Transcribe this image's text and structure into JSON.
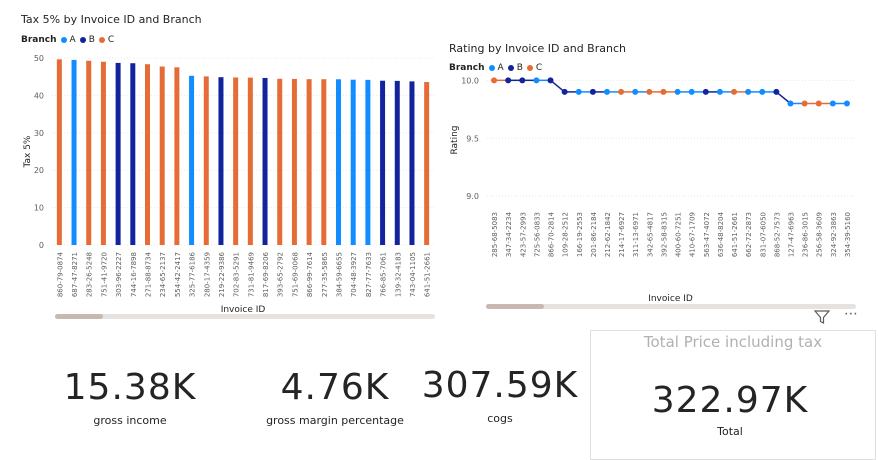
{
  "colors": {
    "A": "#118DFF",
    "B": "#12239E",
    "C": "#E66C37",
    "axis": "#605e5c",
    "grid": "#e8e8e8"
  },
  "left_chart": {
    "title": "Tax 5% by Invoice ID and Branch",
    "legend_title": "Branch",
    "legend": [
      "A",
      "B",
      "C"
    ],
    "xlabel": "Invoice ID",
    "ylabel": "Tax 5%"
  },
  "right_chart": {
    "title": "Rating by Invoice ID and Branch",
    "legend_title": "Branch",
    "legend": [
      "A",
      "B",
      "C"
    ],
    "xlabel": "Invoice ID",
    "ylabel": "Rating"
  },
  "kpis": {
    "gross_income": {
      "value": "15.38K",
      "label": "gross income"
    },
    "gross_margin": {
      "value": "4.76K",
      "label": "gross margin percentage"
    },
    "cogs": {
      "value": "307.59K",
      "label": "cogs"
    }
  },
  "total_card": {
    "title": "Total Price including tax",
    "value": "322.97K",
    "label": "Total"
  },
  "icons": [
    "filter-icon",
    "more-options-icon"
  ],
  "chart_data": [
    {
      "type": "bar",
      "title": "Tax 5% by Invoice ID and Branch",
      "xlabel": "Invoice ID",
      "ylabel": "Tax 5%",
      "ylim": [
        0,
        50
      ],
      "yticks": [
        0,
        10,
        20,
        30,
        40,
        50
      ],
      "grid": true,
      "legend_placement": "top-left",
      "categories": [
        "860-79-0874",
        "687-47-8271",
        "283-26-5248",
        "751-41-9720",
        "303-96-2227",
        "744-16-7898",
        "271-88-8734",
        "234-65-2137",
        "554-42-2417",
        "325-77-6186",
        "280-17-4359",
        "219-22-9386",
        "702-83-5291",
        "731-81-9469",
        "817-69-8206",
        "393-65-2792",
        "751-69-0068",
        "866-99-7614",
        "277-35-5865",
        "384-59-6655",
        "704-48-3927",
        "827-77-7633",
        "766-85-7061",
        "139-32-4183",
        "743-04-1105",
        "641-51-2661"
      ],
      "branches": [
        "C",
        "A",
        "C",
        "C",
        "B",
        "B",
        "C",
        "C",
        "C",
        "A",
        "C",
        "B",
        "C",
        "C",
        "B",
        "C",
        "C",
        "C",
        "C",
        "A",
        "A",
        "A",
        "B",
        "B",
        "B",
        "C"
      ],
      "values": [
        49.65,
        49.49,
        49.26,
        49.0,
        48.69,
        48.6,
        48.34,
        47.72,
        47.51,
        45.25,
        45.09,
        44.87,
        44.8,
        44.75,
        44.66,
        44.44,
        44.4,
        44.34,
        44.33,
        44.31,
        44.2,
        44.15,
        43.93,
        43.88,
        43.75,
        43.57
      ]
    },
    {
      "type": "line",
      "title": "Rating by Invoice ID and Branch",
      "xlabel": "Invoice ID",
      "ylabel": "Rating",
      "ylim": [
        8.95,
        10.02
      ],
      "yticks": [
        9.0,
        9.5,
        10.0
      ],
      "grid": true,
      "legend_placement": "top-left",
      "categories": [
        "285-68-5083",
        "347-34-2234",
        "423-57-2993",
        "725-56-0833",
        "866-70-2814",
        "109-28-2512",
        "166-19-2553",
        "201-86-2184",
        "212-62-1842",
        "214-17-6927",
        "311-13-6971",
        "342-65-4817",
        "392-58-8315",
        "400-60-7251",
        "410-67-1709",
        "563-47-4072",
        "636-48-8204",
        "641-51-2661",
        "662-72-2873",
        "831-07-6050",
        "868-52-7573",
        "127-47-6963",
        "236-86-3015",
        "256-58-3609",
        "324-92-3863",
        "354-39-5160"
      ],
      "branches": [
        "C",
        "B",
        "B",
        "A",
        "B",
        "B",
        "A",
        "B",
        "A",
        "C",
        "A",
        "C",
        "C",
        "A",
        "A",
        "B",
        "A",
        "C",
        "A",
        "A",
        "B",
        "A",
        "C",
        "C",
        "A",
        "A"
      ],
      "values": [
        10.0,
        10.0,
        10.0,
        10.0,
        10.0,
        9.9,
        9.9,
        9.9,
        9.9,
        9.9,
        9.9,
        9.9,
        9.9,
        9.9,
        9.9,
        9.9,
        9.9,
        9.9,
        9.9,
        9.9,
        9.9,
        9.8,
        9.8,
        9.8,
        9.8,
        9.8
      ]
    }
  ]
}
